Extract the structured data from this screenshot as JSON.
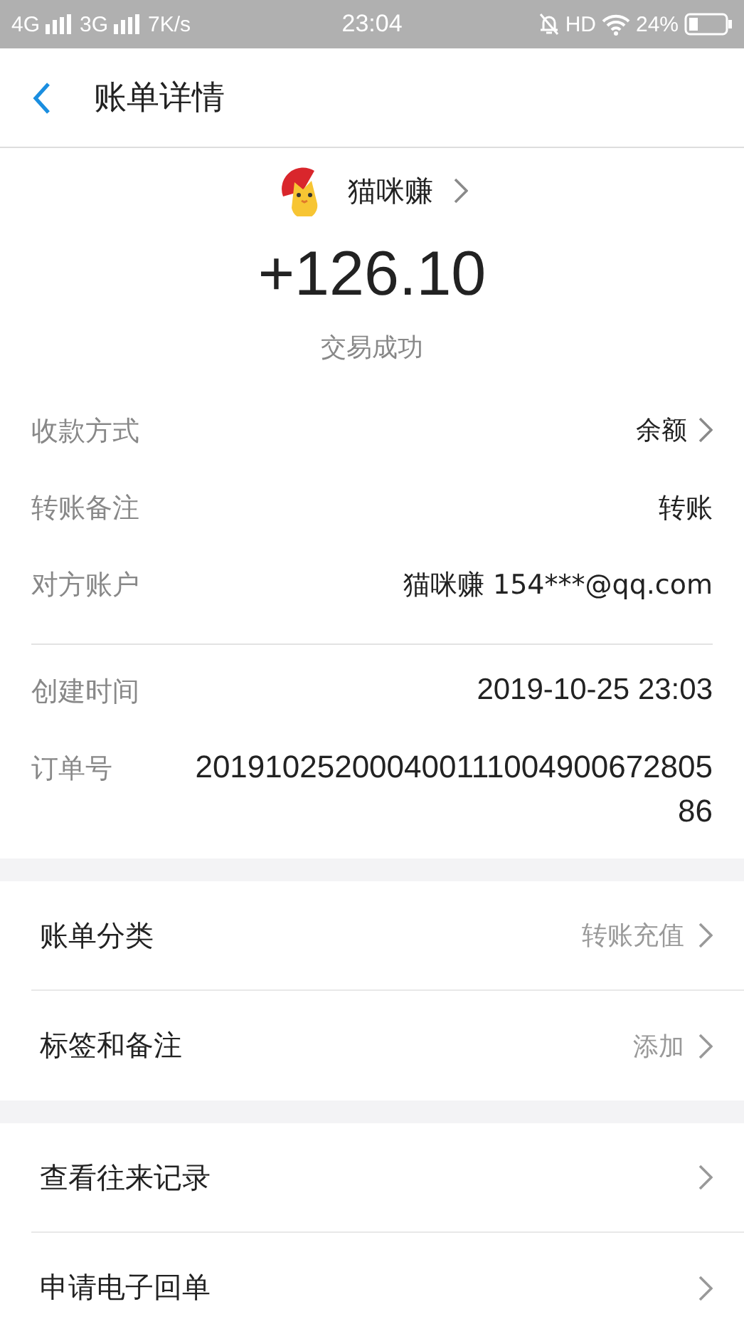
{
  "status_bar": {
    "network_1": "4G",
    "network_2": "3G",
    "speed": "7K/s",
    "time": "23:04",
    "hd": "HD",
    "battery": "24%"
  },
  "header": {
    "title": "账单详情"
  },
  "merchant": {
    "name": "猫咪赚"
  },
  "amount": "+126.10",
  "result": "交易成功",
  "details": [
    {
      "label": "收款方式",
      "value": "余额",
      "link": true
    },
    {
      "label": "转账备注",
      "value": "转账",
      "link": false
    },
    {
      "label": "对方账户",
      "value": "猫咪赚 154***@qq.com",
      "link": false
    }
  ],
  "details_2": [
    {
      "label": "创建时间",
      "value": "2019-10-25 23:03"
    },
    {
      "label": "订单号",
      "value": "20191025200040011100490067280586"
    }
  ],
  "sections": [
    [
      {
        "label": "账单分类",
        "value": "转账充值"
      },
      {
        "label": "标签和备注",
        "value": "添加"
      }
    ],
    [
      {
        "label": "查看往来记录"
      },
      {
        "label": "申请电子回单"
      }
    ]
  ]
}
